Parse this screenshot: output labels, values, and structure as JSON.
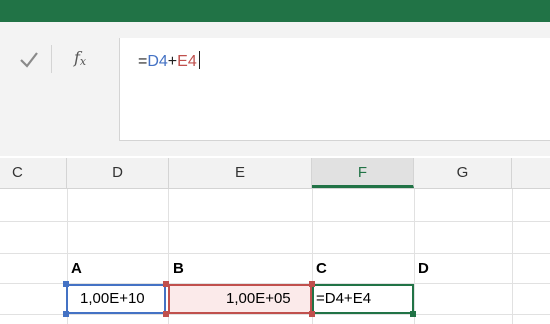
{
  "formula_bar": {
    "prefix": "=",
    "ref1": "D4",
    "operator": "+",
    "ref2": "E4"
  },
  "columns": {
    "c": "C",
    "d": "D",
    "e": "E",
    "f": "F",
    "g": "G",
    "active": "F"
  },
  "cells": {
    "d3": "A",
    "e3": "B",
    "f3": "C",
    "g3": "D",
    "d4": "1,00E+10",
    "e4": "1,00E+05",
    "f4": "=D4+E4"
  },
  "colors": {
    "ribbon": "#217346",
    "ref_d": "#4472c4",
    "ref_e": "#c0504d",
    "active_cell": "#217346"
  },
  "icons": {
    "confirm": "check-icon",
    "function": "fx-icon"
  }
}
